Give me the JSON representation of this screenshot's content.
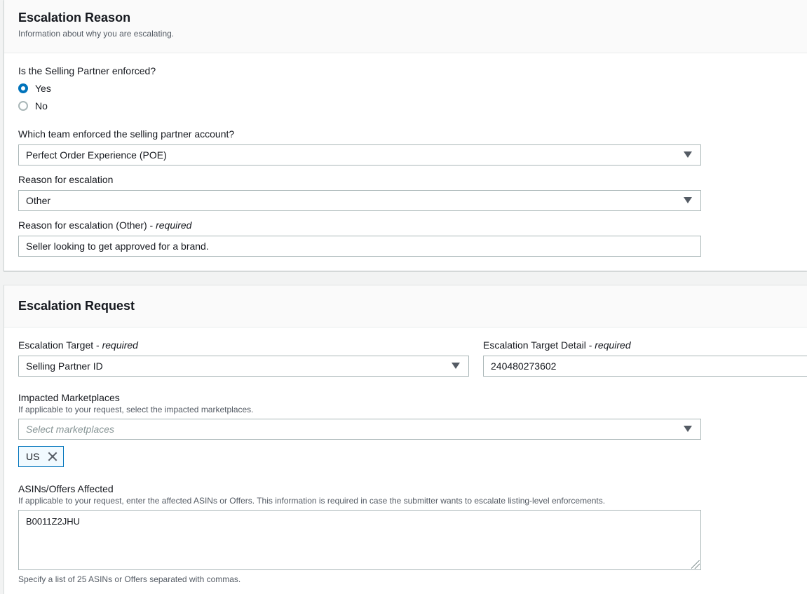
{
  "escalation_reason": {
    "title": "Escalation Reason",
    "subtitle": "Information about why you are escalating.",
    "enforced_question": "Is the Selling Partner enforced?",
    "enforced_options": [
      {
        "label": "Yes",
        "checked": true
      },
      {
        "label": "No",
        "checked": false
      }
    ],
    "team_label": "Which team enforced the selling partner account?",
    "team_value": "Perfect Order Experience (POE)",
    "reason_label": "Reason for escalation",
    "reason_value": "Other",
    "reason_other_label": "Reason for escalation (Other) - ",
    "required_text": "required",
    "reason_other_value": "Seller looking to get approved for a brand."
  },
  "escalation_request": {
    "title": "Escalation Request",
    "target_label": "Escalation Target - ",
    "target_value": "Selling Partner ID",
    "target_detail_label": "Escalation Target Detail - ",
    "target_detail_value": "240480273602",
    "marketplaces_label": "Impacted Marketplaces",
    "marketplaces_desc": "If applicable to your request, select the impacted marketplaces.",
    "marketplaces_placeholder": "Select marketplaces",
    "selected_marketplaces": [
      "US"
    ],
    "asins_label": "ASINs/Offers Affected",
    "asins_desc": "If applicable to your request, enter the affected ASINs or Offers. This information is required in case the submitter wants to escalate listing-level enforcements.",
    "asins_value": "B0011Z2JHU",
    "asins_hint": "Specify a list of 25 ASINs or Offers separated with commas."
  },
  "icons": {
    "caret": "caret-down-icon",
    "remove": "close-icon",
    "resize": "resize-handle-icon"
  },
  "colors": {
    "accent": "#0073bb",
    "token_bg": "#f1faff"
  }
}
